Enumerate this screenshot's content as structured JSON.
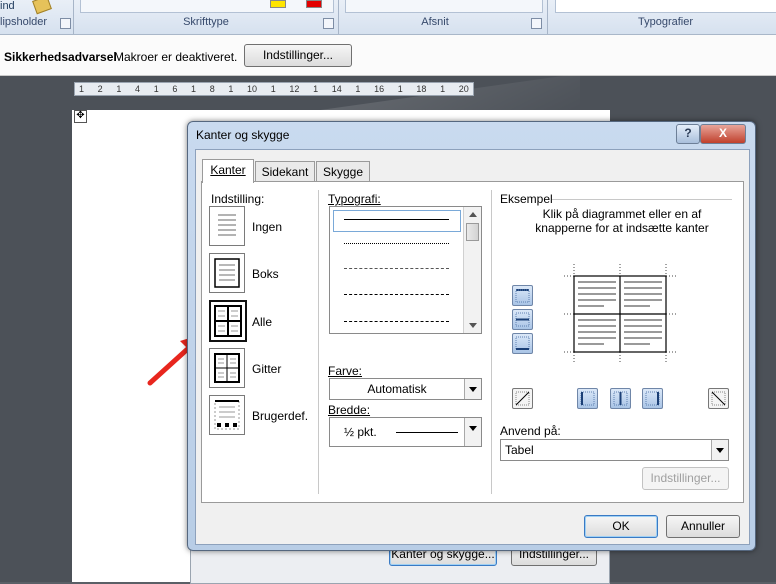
{
  "ribbon": {
    "find_label": "ind",
    "clipboard_group": "lipsholder",
    "font_group": "Skrifttype",
    "paragraph_group": "Afsnit",
    "styles_group": "Typografier"
  },
  "security_bar": {
    "title": "Sikkerhedsadvarsel",
    "message": "Makroer er deaktiveret.",
    "button": "Indstillinger..."
  },
  "ruler": {
    "marks": [
      "1",
      "2",
      "1",
      "4",
      "1",
      "6",
      "1",
      "8",
      "1",
      "10",
      "1",
      "12",
      "1",
      "14",
      "1",
      "16",
      "1",
      "18",
      "1",
      "20"
    ]
  },
  "background_dialog": {
    "borders_button": "Kanter og skygge...",
    "options_button": "Indstillinger..."
  },
  "dialog": {
    "title": "Kanter og skygge",
    "help": "?",
    "close": "X",
    "tabs": [
      {
        "label": "Kanter",
        "active": true
      },
      {
        "label": "Sidekant",
        "active": false
      },
      {
        "label": "Skygge",
        "active": false
      }
    ],
    "setting_heading": "Indstilling:",
    "settings": [
      {
        "label": "Ingen",
        "selected": false
      },
      {
        "label": "Boks",
        "selected": false
      },
      {
        "label": "Alle",
        "selected": true
      },
      {
        "label": "Gitter",
        "selected": false
      },
      {
        "label": "Brugerdef.",
        "selected": false
      }
    ],
    "style_heading": "Typografi:",
    "color_label": "Farve:",
    "color_value": "Automatisk",
    "width_label": "Bredde:",
    "width_value": "½ pkt.",
    "preview_heading": "Eksempel",
    "preview_hint": "Klik på diagrammet eller en af knapperne for at indsætte kanter",
    "apply_label": "Anvend på:",
    "apply_value": "Tabel",
    "options_button": "Indstillinger...",
    "ok": "OK",
    "cancel": "Annuller"
  },
  "annotation": {
    "arrow_color": "#e8261e"
  }
}
